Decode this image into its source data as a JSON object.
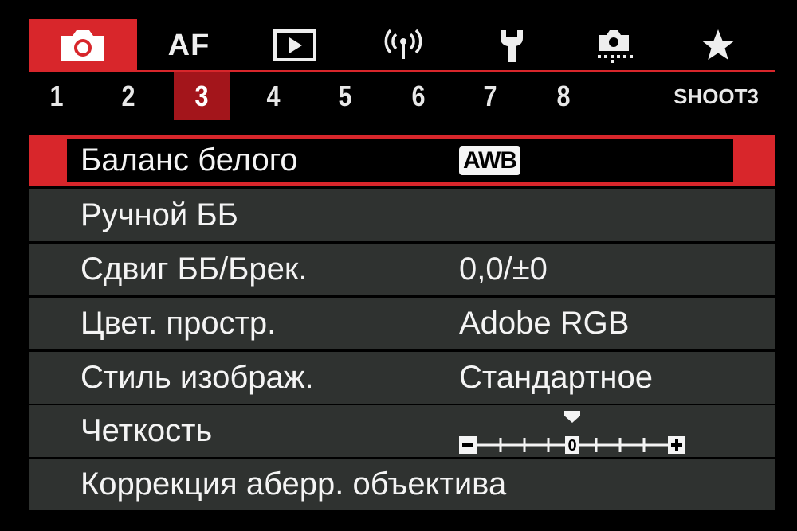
{
  "tabs": [
    {
      "name": "camera-icon",
      "label": ""
    },
    {
      "name": "af",
      "label": "AF"
    },
    {
      "name": "playback-icon",
      "label": ""
    },
    {
      "name": "wireless-icon",
      "label": ""
    },
    {
      "name": "wrench-icon",
      "label": ""
    },
    {
      "name": "custom-functions-icon",
      "label": ""
    },
    {
      "name": "star-icon",
      "label": ""
    }
  ],
  "active_tab": 0,
  "pages": [
    "1",
    "2",
    "3",
    "4",
    "5",
    "6",
    "7",
    "8"
  ],
  "active_page": "3",
  "page_label": "SHOOT3",
  "menu": {
    "white_balance": {
      "label": "Баланс белого",
      "value": "AWB"
    },
    "custom_wb": {
      "label": "Ручной ББ"
    },
    "wb_shift": {
      "label": "Сдвиг ББ/Брек.",
      "value": "0,0/±0"
    },
    "color_space": {
      "label": "Цвет. простр.",
      "value": "Adobe RGB"
    },
    "picture_style": {
      "label": "Стиль изображ.",
      "value": "Стандартное"
    },
    "clarity": {
      "label": "Четкость",
      "value": 0,
      "min": -4,
      "max": 4,
      "marker_label": "0"
    },
    "lens_correction": {
      "label": "Коррекция аберр. объектива"
    }
  },
  "colors": {
    "accent": "#d8262b",
    "page_active": "#a3151b",
    "row_bg": "#2f3230",
    "text": "#f4f4f4"
  }
}
